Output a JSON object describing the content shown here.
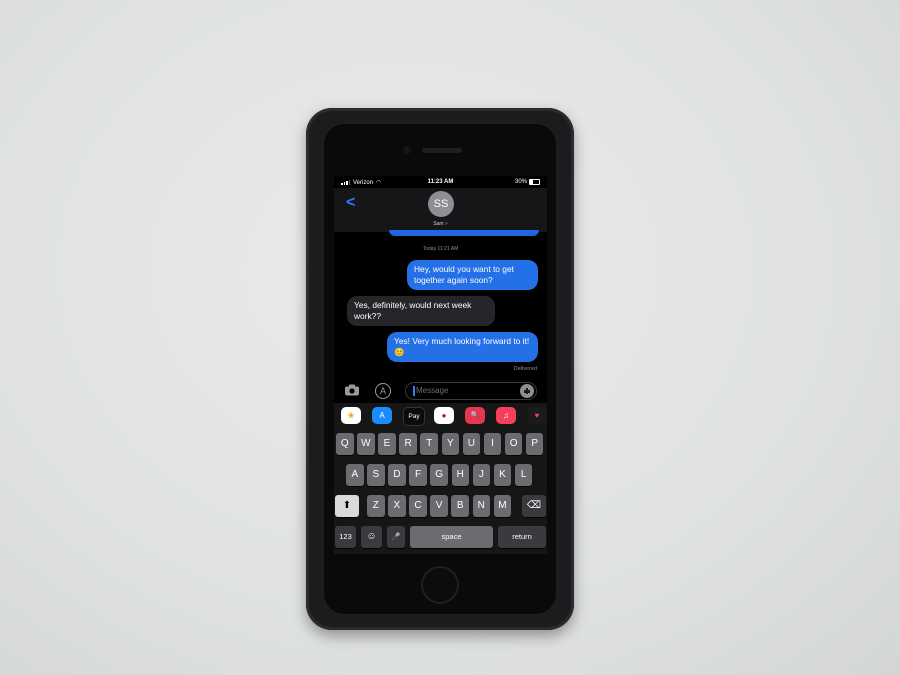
{
  "status_bar": {
    "carrier": "Verizon",
    "time": "11:23 AM",
    "battery": "30%",
    "battery_level": 0.3
  },
  "header": {
    "avatar_initials": "SS",
    "contact_name": "Sam",
    "contact_chevron": ">",
    "back_label": "<"
  },
  "conversation": {
    "timestamp": "Today 11:21 AM",
    "messages": [
      {
        "from": "me",
        "text": "Hey, would you want to get together again soon?"
      },
      {
        "from": "them",
        "text": "Yes, definitely, would next week work??"
      },
      {
        "from": "me",
        "text": "Yes! Very much looking forward to it! 😊"
      }
    ],
    "delivery_status": "Delivered"
  },
  "input": {
    "placeholder": "Message"
  },
  "app_drawer": {
    "apps": [
      {
        "name": "photos-app-icon",
        "glyph": "❀",
        "color": "#ffffff"
      },
      {
        "name": "app-store-app-icon",
        "glyph": "A",
        "color": "#1a8cff"
      },
      {
        "name": "apple-pay-app-icon",
        "glyph": "Pay",
        "color": "#0b0b0b"
      },
      {
        "name": "memoji-app-icon",
        "glyph": "●",
        "color": "#ffffff"
      },
      {
        "name": "images-search-app-icon",
        "glyph": "🔍",
        "color": "#e8364f"
      },
      {
        "name": "music-app-icon",
        "glyph": "♫",
        "color": "#f5405c"
      },
      {
        "name": "digital-touch-app-icon",
        "glyph": "♥",
        "color": "#1b1b1b"
      }
    ]
  },
  "keyboard": {
    "row1": [
      "Q",
      "W",
      "E",
      "R",
      "T",
      "Y",
      "U",
      "I",
      "O",
      "P"
    ],
    "row2": [
      "A",
      "S",
      "D",
      "F",
      "G",
      "H",
      "J",
      "K",
      "L"
    ],
    "row3": [
      "Z",
      "X",
      "C",
      "V",
      "B",
      "N",
      "M"
    ],
    "shift": "⬆",
    "delete": "⌫",
    "numbers": "123",
    "emoji": "☺",
    "dictation": "🎤",
    "space": "space",
    "return": "return"
  }
}
